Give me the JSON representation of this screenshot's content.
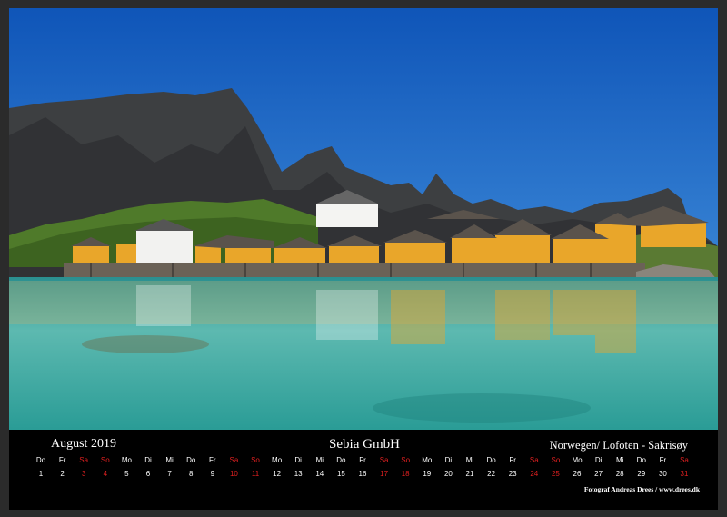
{
  "calendar": {
    "month_label": "August 2019",
    "company": "Sebia GmbH",
    "location": "Norwegen/ Lofoten - Sakrisøy",
    "credit": "Fotograf Andreas Drees / www.drees.dk",
    "weekend_color": "#e02020",
    "text_color": "#ffffff",
    "days": [
      {
        "name": "Do",
        "num": "1",
        "weekend": false
      },
      {
        "name": "Fr",
        "num": "2",
        "weekend": false
      },
      {
        "name": "Sa",
        "num": "3",
        "weekend": true
      },
      {
        "name": "So",
        "num": "4",
        "weekend": true
      },
      {
        "name": "Mo",
        "num": "5",
        "weekend": false
      },
      {
        "name": "Di",
        "num": "6",
        "weekend": false
      },
      {
        "name": "Mi",
        "num": "7",
        "weekend": false
      },
      {
        "name": "Do",
        "num": "8",
        "weekend": false
      },
      {
        "name": "Fr",
        "num": "9",
        "weekend": false
      },
      {
        "name": "Sa",
        "num": "10",
        "weekend": true
      },
      {
        "name": "So",
        "num": "11",
        "weekend": true
      },
      {
        "name": "Mo",
        "num": "12",
        "weekend": false
      },
      {
        "name": "Di",
        "num": "13",
        "weekend": false
      },
      {
        "name": "Mi",
        "num": "14",
        "weekend": false
      },
      {
        "name": "Do",
        "num": "15",
        "weekend": false
      },
      {
        "name": "Fr",
        "num": "16",
        "weekend": false
      },
      {
        "name": "Sa",
        "num": "17",
        "weekend": true
      },
      {
        "name": "So",
        "num": "18",
        "weekend": true
      },
      {
        "name": "Mo",
        "num": "19",
        "weekend": false
      },
      {
        "name": "Di",
        "num": "20",
        "weekend": false
      },
      {
        "name": "Mi",
        "num": "21",
        "weekend": false
      },
      {
        "name": "Do",
        "num": "22",
        "weekend": false
      },
      {
        "name": "Fr",
        "num": "23",
        "weekend": false
      },
      {
        "name": "Sa",
        "num": "24",
        "weekend": true
      },
      {
        "name": "So",
        "num": "25",
        "weekend": true
      },
      {
        "name": "Mo",
        "num": "26",
        "weekend": false
      },
      {
        "name": "Di",
        "num": "27",
        "weekend": false
      },
      {
        "name": "Mi",
        "num": "28",
        "weekend": false
      },
      {
        "name": "Do",
        "num": "29",
        "weekend": false
      },
      {
        "name": "Fr",
        "num": "30",
        "weekend": false
      },
      {
        "name": "Sa",
        "num": "31",
        "weekend": true
      }
    ]
  },
  "photo": {
    "sky_color": "#1b63c0",
    "water_color": "#3fb0a8",
    "cabin_color": "#e9a62a"
  }
}
